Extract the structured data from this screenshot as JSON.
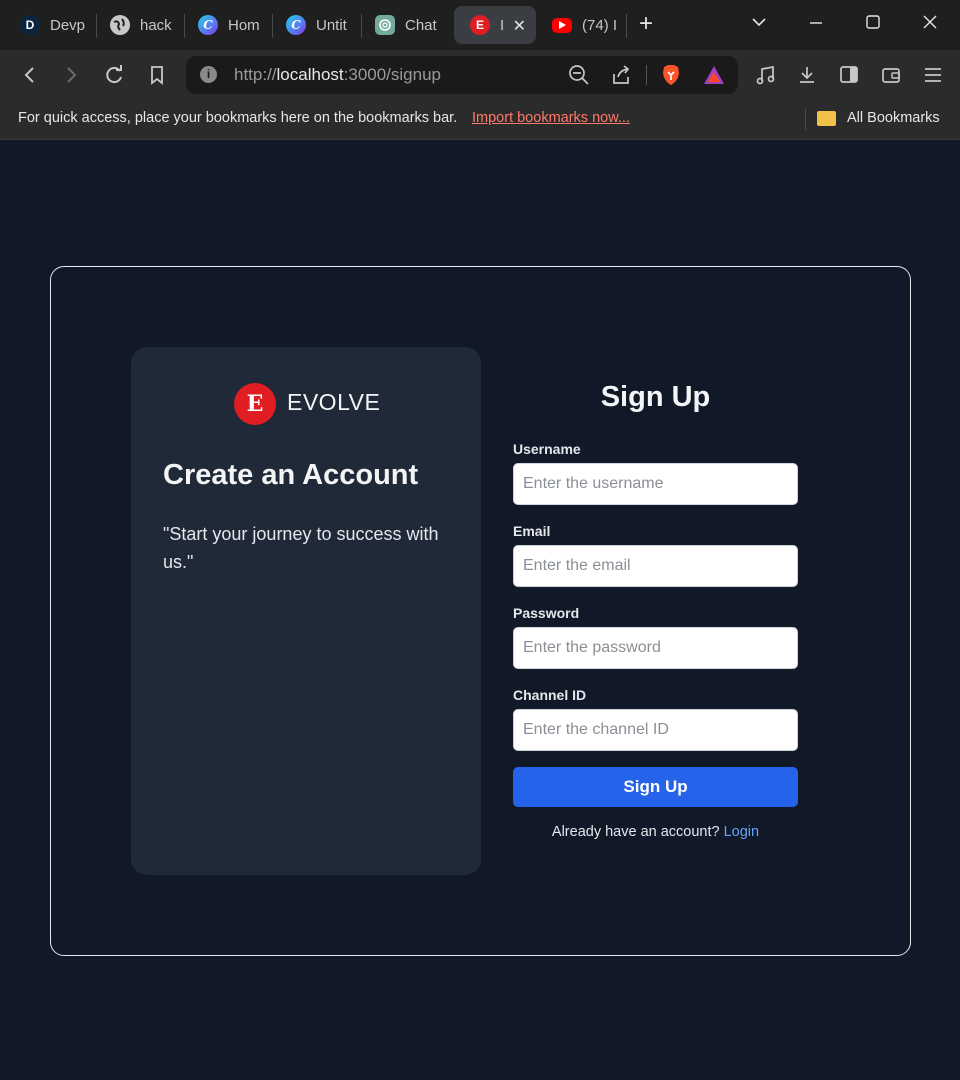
{
  "browser": {
    "tabs": [
      {
        "label": "Devp",
        "icon": "devpost-icon",
        "color": "#0b2540",
        "glyph": "D"
      },
      {
        "label": "hack",
        "icon": "globe-icon",
        "color": "#c8c8c8",
        "glyph": ""
      },
      {
        "label": "Hom",
        "icon": "canva-icon",
        "color": "#3b82f6",
        "glyph": "C"
      },
      {
        "label": "Untit",
        "icon": "canva-icon",
        "color": "#3b82f6",
        "glyph": "C"
      },
      {
        "label": "Chat",
        "icon": "chatgpt-icon",
        "color": "#74aa9c",
        "glyph": ""
      },
      {
        "label": "I",
        "icon": "evolve-icon",
        "color": "#e11d24",
        "glyph": ""
      },
      {
        "label": "(74) I",
        "icon": "youtube-icon",
        "color": "#ff0000",
        "glyph": ""
      }
    ],
    "url_prefix": "http://",
    "url_host": "localhost",
    "url_rest": ":3000/signup",
    "bookmarks_hint": "For quick access, place your bookmarks here on the bookmarks bar.",
    "bookmarks_import": "Import bookmarks now...",
    "bookmarks_all": "All Bookmarks"
  },
  "brand": {
    "name": "EVOLVE",
    "color": "#e11d24"
  },
  "panel": {
    "title": "Create an Account",
    "quote": "\"Start your journey to success with us.\""
  },
  "form": {
    "title": "Sign Up",
    "fields": [
      {
        "label": "Username",
        "placeholder": "Enter the username",
        "value": ""
      },
      {
        "label": "Email",
        "placeholder": "Enter the email",
        "value": ""
      },
      {
        "label": "Password",
        "placeholder": "Enter the password",
        "value": ""
      },
      {
        "label": "Channel ID",
        "placeholder": "Enter the channel ID",
        "value": ""
      }
    ],
    "submit_label": "Sign Up",
    "login_prompt": "Already have an account?",
    "login_link": "Login",
    "accent": "#2563eb"
  }
}
